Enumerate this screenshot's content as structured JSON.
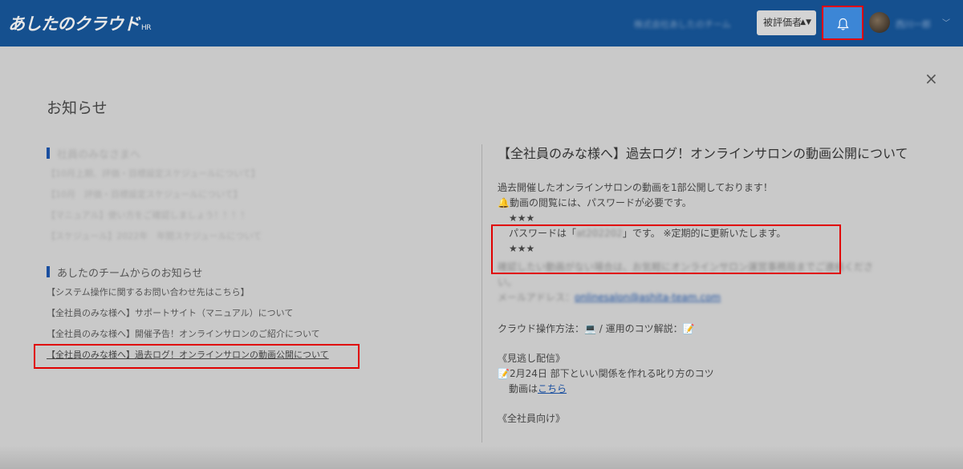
{
  "header": {
    "logo": "あしたのクラウド",
    "logo_suffix": "HR",
    "company": "株式会社あしたのチーム",
    "role_select": "被評価者",
    "role_arrows": "▲▼",
    "user_name": "西川一郎",
    "icons": {
      "notification": "bell-icon",
      "user_menu": "chevron-down-icon"
    },
    "colors": {
      "header_bg": "#15508f",
      "bell_bg": "#3c86d6",
      "highlight": "#e00000"
    }
  },
  "page": {
    "title": "お知らせ",
    "close": "×"
  },
  "company_notices": {
    "heading": "社員のみなさまへ",
    "items": [
      "【10月上期、評価・目標設定スケジュールについて】",
      "【10月　評価・目標設定スケジュールについて】",
      "【マニュアル】使い方をご確認しましょう！！！！",
      "【スケジュール】2022年　年間スケジュールについて"
    ]
  },
  "team_notices": {
    "heading": "あしたのチームからのお知らせ",
    "items": [
      "【システム操作に関するお問い合わせ先はこちら】",
      "【全社員のみな様へ】サポートサイト（マニュアル）について",
      "【全社員のみな様へ】開催予告！オンラインサロンのご紹介について"
    ],
    "selected": "【全社員のみな様へ】過去ログ！オンラインサロンの動画公開について"
  },
  "detail": {
    "title": "【全社員のみな様へ】過去ログ！オンラインサロンの動画公開について",
    "line1": "過去開催したオンラインサロンの動画を1部公開しております！",
    "line2": "🔔動画の閲覧には、パスワードが必要です。",
    "stars1": "★★★",
    "pw_prefix": "パスワードは「",
    "pw_value": "at202202",
    "pw_suffix": "」です。 ※定期的に更新いたします。",
    "stars2": "★★★",
    "blur1": "確認したい動画がない場合は、お気軽にオンラインサロン運営事務局までご連絡くださ",
    "blur2": "い。",
    "mail_label": "メールアドレス：",
    "mail_value": "onlinesalon@ashita-team.com",
    "ops_label": "クラウド操作方法：",
    "ops_icon": "💻",
    "ops_mid": " / 運用のコツ解説：",
    "ops_icon2": "📝",
    "replay_heading": "《見逃し配信》",
    "replay_item": "📝2月24日 部下といい関係を作れる叱り方のコツ",
    "replay_link_prefix": "動画は",
    "replay_link": "こちら",
    "next_heading": "《全社員向け》"
  }
}
